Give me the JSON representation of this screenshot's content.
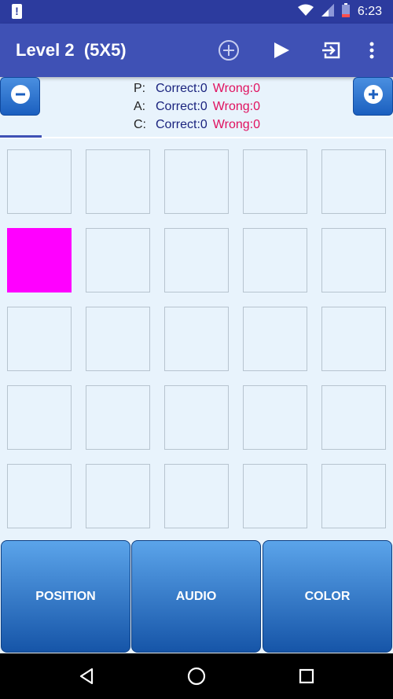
{
  "status_bar": {
    "time": "6:23",
    "alert_glyph": "!"
  },
  "app_bar": {
    "title": "Level 2  (5X5)",
    "actions": [
      "add-circle-icon",
      "play-icon",
      "exit-icon",
      "more-vert-icon"
    ]
  },
  "score_panel": {
    "decrease_icon": "minus-circle-icon",
    "increase_icon": "plus-circle-icon",
    "rows": [
      {
        "key": "P:",
        "correct": "Correct:0",
        "wrong": "Wrong:0"
      },
      {
        "key": "A:",
        "correct": "Correct:0",
        "wrong": "Wrong:0"
      },
      {
        "key": "C:",
        "correct": "Correct:0",
        "wrong": "Wrong:0"
      }
    ]
  },
  "grid": {
    "rows": 5,
    "cols": 5,
    "active_cell": {
      "row": 2,
      "col": 1
    },
    "active_color": "#ff00ff"
  },
  "buttons": {
    "position": "POSITION",
    "audio": "AUDIO",
    "color": "COLOR"
  },
  "colors": {
    "primary": "#3f51b5",
    "status_bar": "#2c3b9e",
    "wrong": "#e0115f",
    "correct": "#1a237e",
    "background": "#e8f3fc"
  }
}
